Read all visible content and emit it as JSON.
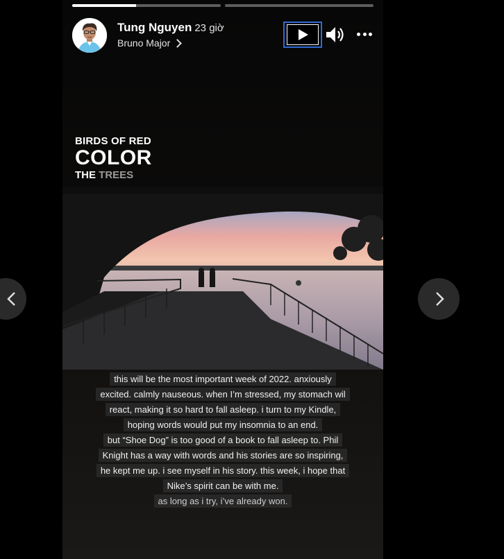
{
  "story": {
    "progress": [
      0.43,
      0.0
    ],
    "author": {
      "name": "Tung Nguyen",
      "time": "23 giờ"
    },
    "music": {
      "artist": "Bruno Major"
    },
    "title": {
      "line1": "BIRDS OF RED",
      "line2": "COLOR",
      "line3_a": "THE",
      "line3_b": "TREES"
    },
    "caption": [
      "this will be the most important week of 2022. anxiously",
      "excited. calmly nauseous. when I’m stressed, my stomach wil",
      "react, making it so hard to fall asleep. i turn to my Kindle,",
      "hoping words would put my insomnia to an end.",
      "but “Shoe Dog” is too good of a book to fall asleep to. Phil",
      "Knight has a way with words and his stories are so inspiring,",
      "he kept me up. i see myself in his story. this week, i hope that",
      "Nike’s spirit can be with me.",
      "as long as i try, i’ve already won."
    ]
  },
  "icons": {
    "play": "play-icon",
    "sound": "volume-icon",
    "more": "more-icon",
    "prev": "chevron-left-icon",
    "next": "chevron-right-icon"
  },
  "colors": {
    "focus_outline": "#2f6bd8",
    "background": "#000000"
  }
}
